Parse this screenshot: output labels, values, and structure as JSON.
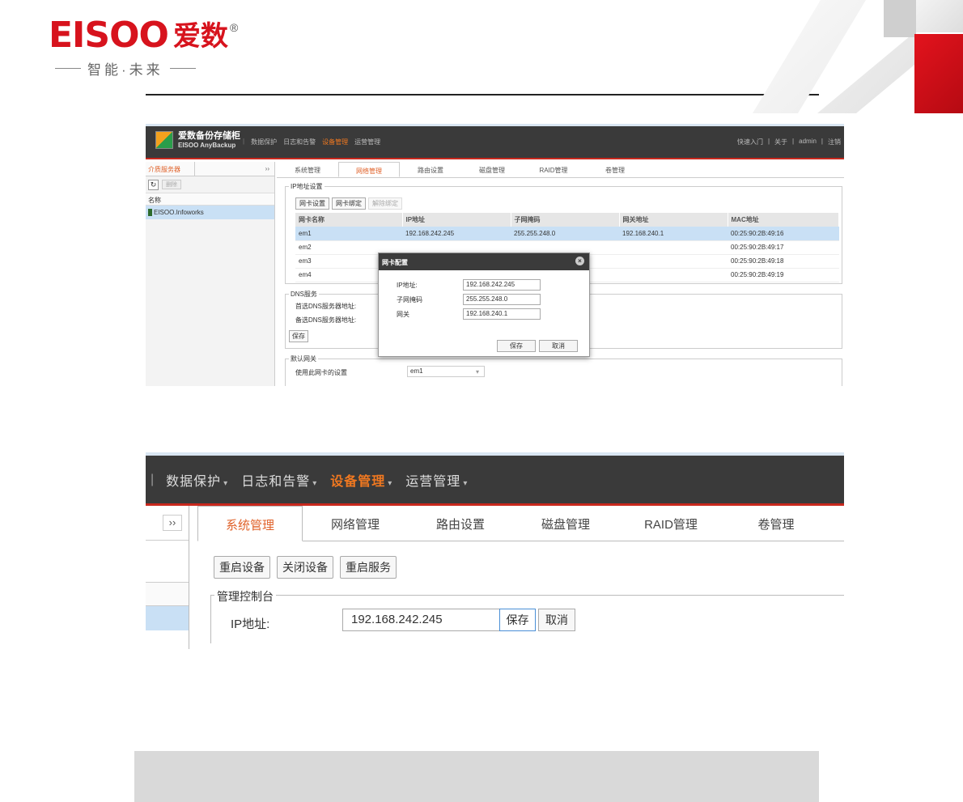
{
  "header": {
    "logo_en": "EISOO",
    "logo_cn": "爱数",
    "registered": "®",
    "slogan": "智能·未来"
  },
  "shot1": {
    "brand": "爱数备份存储柜",
    "brand_sub": "EISOO AnyBackup",
    "nav": [
      "数据保护",
      "日志和告警",
      "设备管理",
      "运营管理"
    ],
    "nav_active_index": 2,
    "top_right": [
      "快速入门",
      "关于",
      "admin",
      "注销"
    ],
    "sidebar": {
      "tab": "介质服务器",
      "chevron": "››",
      "delete_label": "删除",
      "column": "名称",
      "item": "EISOO.Infoworks"
    },
    "tabs": [
      "系统管理",
      "网络管理",
      "路由设置",
      "磁盘管理",
      "RAID管理",
      "卷管理"
    ],
    "tab_active_index": 1,
    "ip_section": {
      "legend": "IP地址设置",
      "buttons": [
        "网卡设置",
        "网卡绑定",
        "解除绑定"
      ],
      "columns": [
        "网卡名称",
        "IP地址",
        "子网掩码",
        "网关地址",
        "MAC地址"
      ],
      "rows": [
        [
          "em1",
          "192.168.242.245",
          "255.255.248.0",
          "192.168.240.1",
          "00:25:90:2B:49:16"
        ],
        [
          "em2",
          "",
          "",
          "",
          "00:25:90:2B:49:17"
        ],
        [
          "em3",
          "",
          "",
          "",
          "00:25:90:2B:49:18"
        ],
        [
          "em4",
          "",
          "",
          "",
          "00:25:90:2B:49:19"
        ]
      ]
    },
    "dns_section": {
      "legend": "DNS服务",
      "primary_label": "首选DNS服务器地址:",
      "secondary_label": "备选DNS服务器地址:",
      "save": "保存"
    },
    "gw_section": {
      "legend": "默认网关",
      "use_label": "使用此网卡的设置",
      "selected": "em1"
    },
    "dialog": {
      "title": "网卡配置",
      "ip_label": "IP地址:",
      "ip_value": "192.168.242.245",
      "mask_label": "子网掩码",
      "mask_value": "255.255.248.0",
      "gw_label": "网关",
      "gw_value": "192.168.240.1",
      "save": "保存",
      "cancel": "取消"
    }
  },
  "shot2": {
    "nav": [
      "数据保护",
      "日志和告警",
      "设备管理",
      "运营管理"
    ],
    "separator": "|",
    "chevron": "››",
    "tabs": [
      "系统管理",
      "网络管理",
      "路由设置",
      "磁盘管理",
      "RAID管理",
      "卷管理"
    ],
    "buttons": [
      "重启设备",
      "关闭设备",
      "重启服务"
    ],
    "legend": "管理控制台",
    "ip_label": "IP地址:",
    "ip_value": "192.168.242.245",
    "save": "保存",
    "cancel": "取消"
  },
  "colors": {
    "brand_red": "#d7131d",
    "accent_orange": "#f07820",
    "selection_blue": "#c9e0f5",
    "toolbar_dark": "#3a3a3a"
  }
}
